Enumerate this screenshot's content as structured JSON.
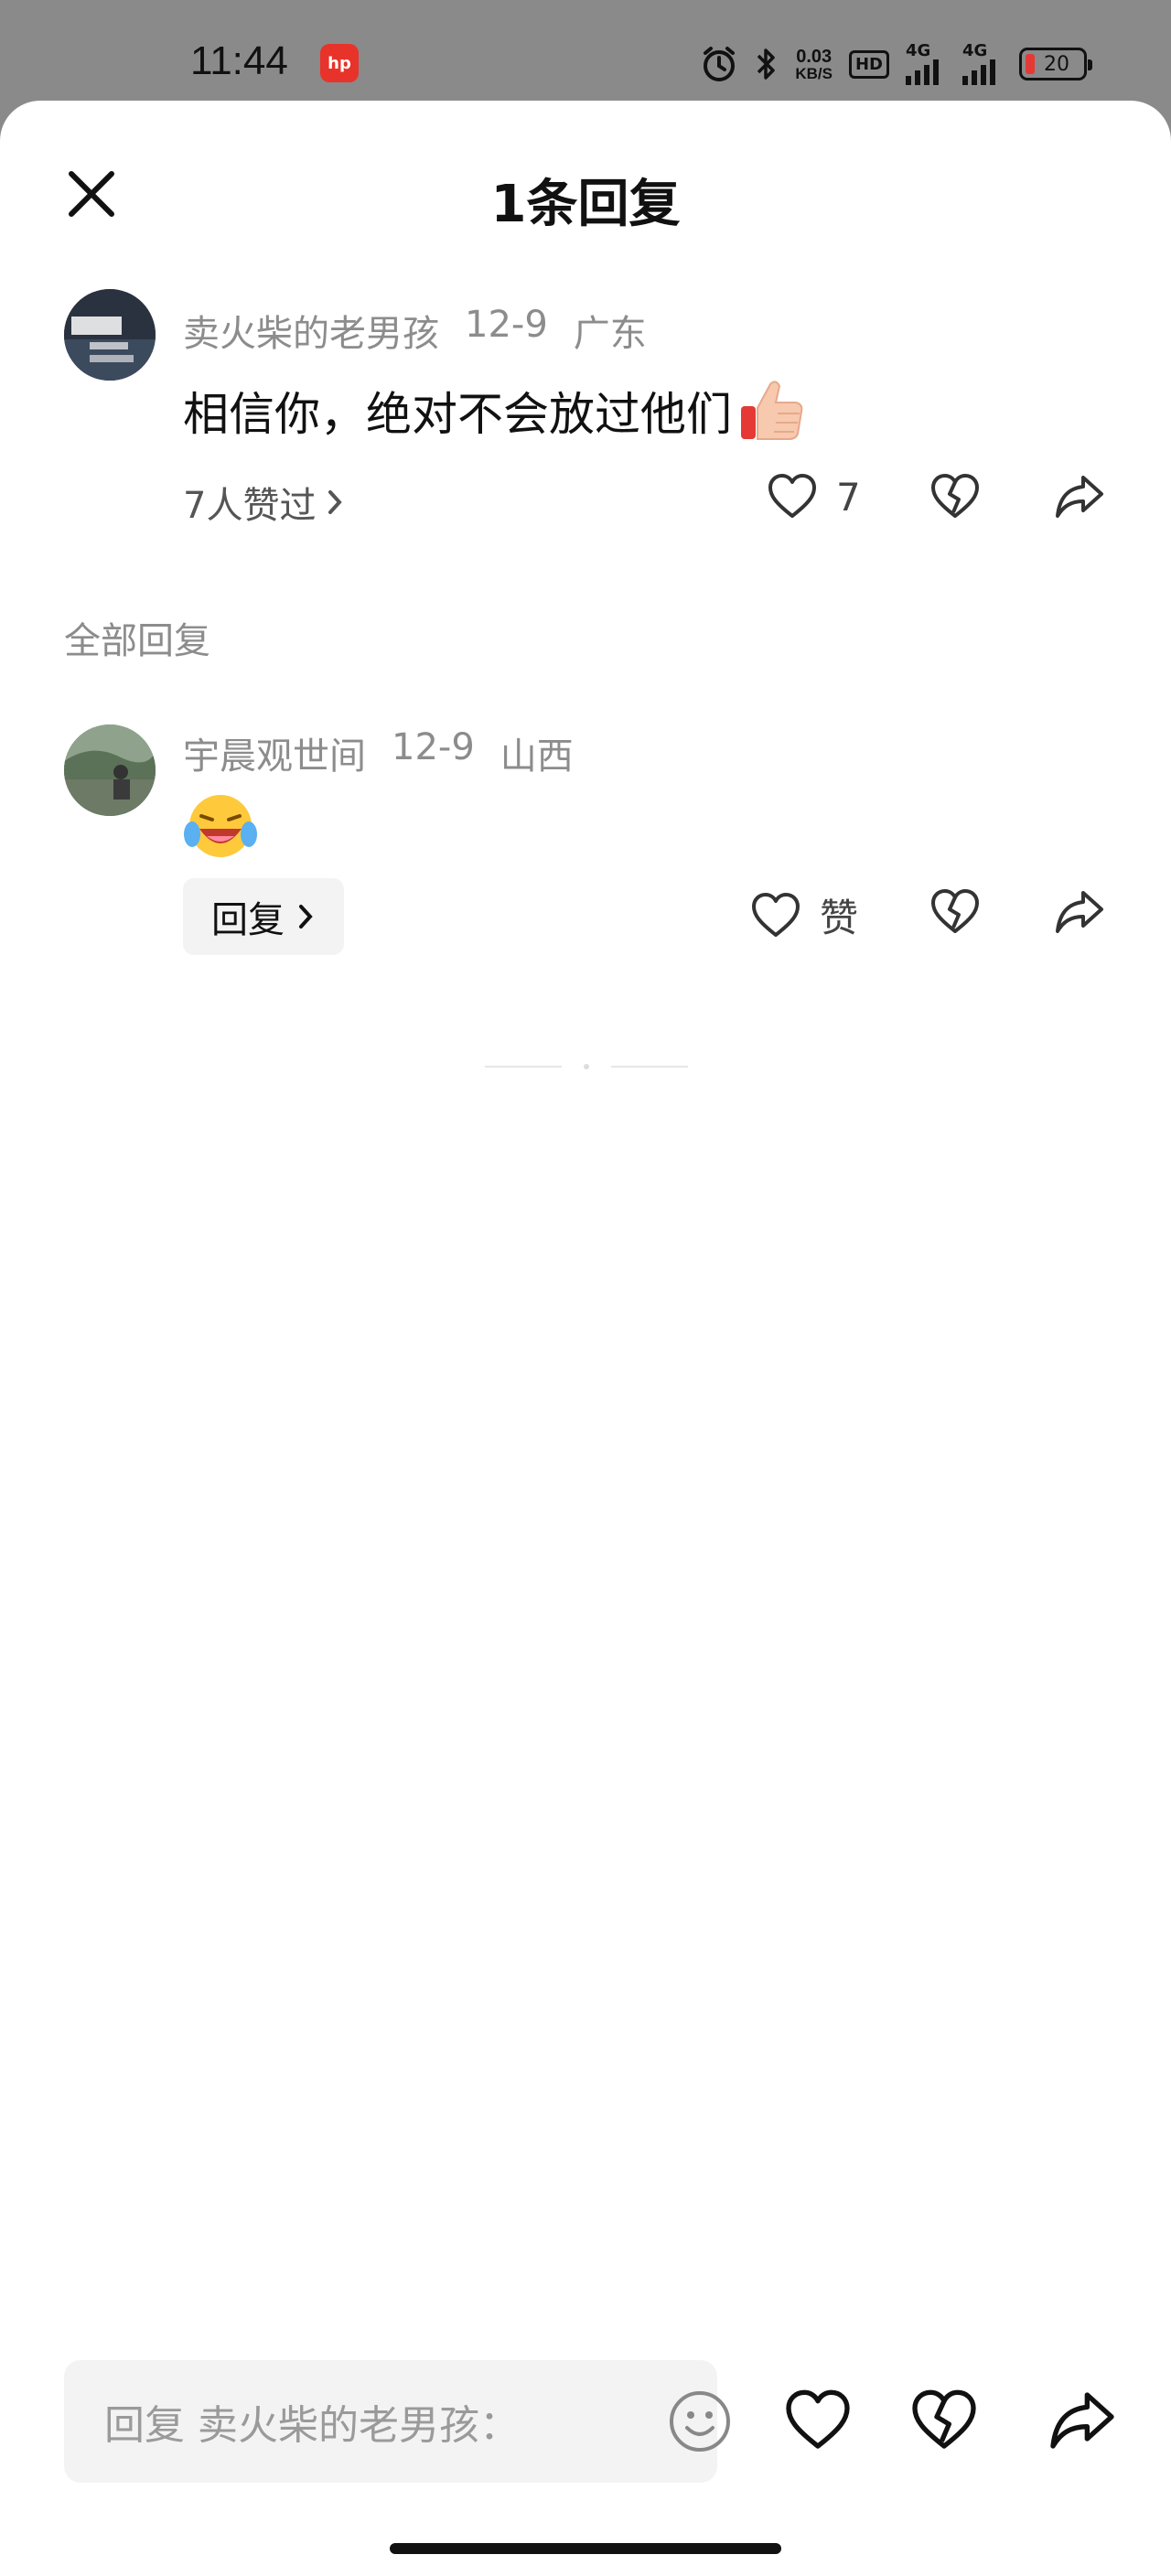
{
  "status_bar": {
    "time": "11:44",
    "app_icon": "app-logo-icon",
    "net_speed_value": "0.03",
    "net_speed_unit": "KB/S",
    "hd_label": "HD",
    "network_1": "4G",
    "network_2": "4G",
    "battery": "20"
  },
  "header": {
    "title": "1条回复",
    "close_icon": "close-icon"
  },
  "main_comment": {
    "author": "卖火柴的老男孩",
    "date": "12-9",
    "location": "广东",
    "text": "相信你，绝对不会放过他们",
    "emoji": "thumbs-up",
    "likers_text": "7人赞过",
    "like_count": "7"
  },
  "section": {
    "label": "全部回复"
  },
  "replies": [
    {
      "author": "宇晨观世间",
      "date": "12-9",
      "location": "山西",
      "emoji": "laughing-crying",
      "reply_label": "回复",
      "like_label": "赞"
    }
  ],
  "bottom_bar": {
    "placeholder": "回复 卖火柴的老男孩："
  },
  "colors": {
    "status_bar_bg": "#8a8a8a",
    "sheet_bg": "#ffffff",
    "secondary_text": "#8c8c8c",
    "chip_bg": "#f3f3f3",
    "battery_low": "#e53935",
    "app_icon_red": "#e8332a"
  }
}
